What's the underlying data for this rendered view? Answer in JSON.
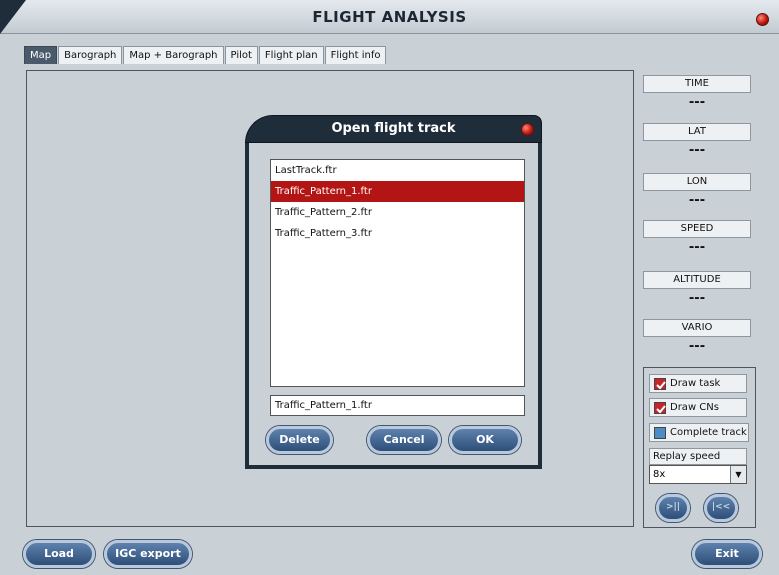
{
  "window": {
    "title": "FLIGHT ANALYSIS"
  },
  "tabs": [
    {
      "label": "Map",
      "active": true
    },
    {
      "label": "Barograph",
      "active": false
    },
    {
      "label": "Map + Barograph",
      "active": false
    },
    {
      "label": "Pilot",
      "active": false
    },
    {
      "label": "Flight plan",
      "active": false
    },
    {
      "label": "Flight info",
      "active": false
    }
  ],
  "info_panel": [
    {
      "label": "TIME",
      "value": "---"
    },
    {
      "label": "LAT",
      "value": "---"
    },
    {
      "label": "LON",
      "value": "---"
    },
    {
      "label": "SPEED",
      "value": "---"
    },
    {
      "label": "ALTITUDE",
      "value": "---"
    },
    {
      "label": "VARIO",
      "value": "---"
    }
  ],
  "options": {
    "draw_task": {
      "label": "Draw task",
      "checked": true
    },
    "draw_cns": {
      "label": "Draw CNs",
      "checked": true
    },
    "complete_track": {
      "label": "Complete track",
      "checked": false
    },
    "replay_speed_label": "Replay speed",
    "replay_speed_value": "8x",
    "play_pause_label": ">||",
    "rewind_label": "|<<"
  },
  "bottom": {
    "load_label": "Load",
    "igc_label": "IGC export",
    "exit_label": "Exit"
  },
  "dialog": {
    "title": "Open flight track",
    "files": [
      "LastTrack.ftr",
      "Traffic_Pattern_1.ftr",
      "Traffic_Pattern_2.ftr",
      "Traffic_Pattern_3.ftr"
    ],
    "selected": "Traffic_Pattern_1.ftr",
    "file_name_value": "Traffic_Pattern_1.ftr",
    "delete_label": "Delete",
    "cancel_label": "Cancel",
    "ok_label": "OK"
  },
  "colors": {
    "accent_red": "#b31414",
    "frame_dark": "#1f2d3a",
    "button_blue": "#3f6290"
  }
}
